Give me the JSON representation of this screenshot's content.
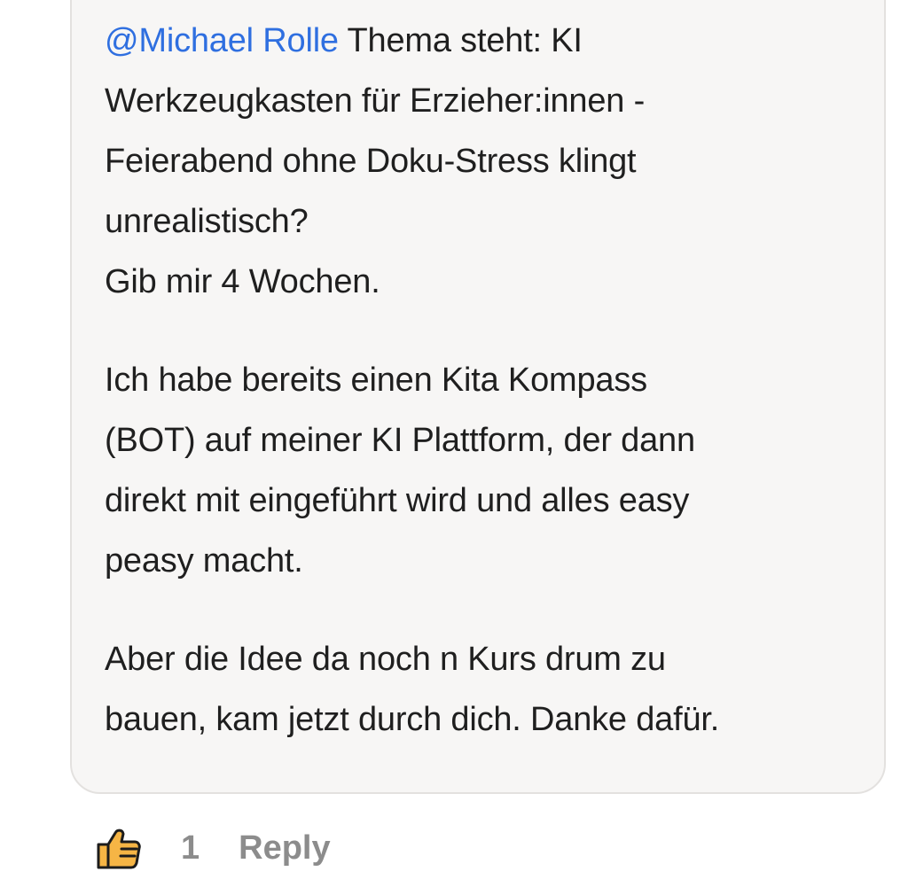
{
  "comment": {
    "mention": "@Michael Rolle",
    "line1": " Thema steht: KI",
    "line2": "Werkzeugkasten für Erzieher:innen -",
    "line3": "Feierabend ohne Doku-Stress klingt",
    "line4": "unrealistisch?",
    "line5": "Gib mir 4 Wochen.",
    "paragraph2_line1": "Ich habe bereits einen Kita Kompass",
    "paragraph2_line2": "(BOT) auf meiner KI Plattform, der dann",
    "paragraph2_line3": "direkt mit eingeführt wird und alles easy",
    "paragraph2_line4": "peasy macht.",
    "paragraph3_line1": "Aber die Idee da noch n Kurs drum zu",
    "paragraph3_line2": "bauen, kam jetzt durch dich. Danke dafür."
  },
  "actions": {
    "like_icon": "thumbs-up-icon",
    "like_count": "1",
    "reply_label": "Reply"
  },
  "colors": {
    "mention": "#2f6fe0",
    "thumb_fill": "#f6b545",
    "thumb_outline": "#1c1c1c",
    "action_text": "#8c8c8c",
    "bubble_background": "#f7f6f5",
    "bubble_border": "#e3e1df"
  }
}
